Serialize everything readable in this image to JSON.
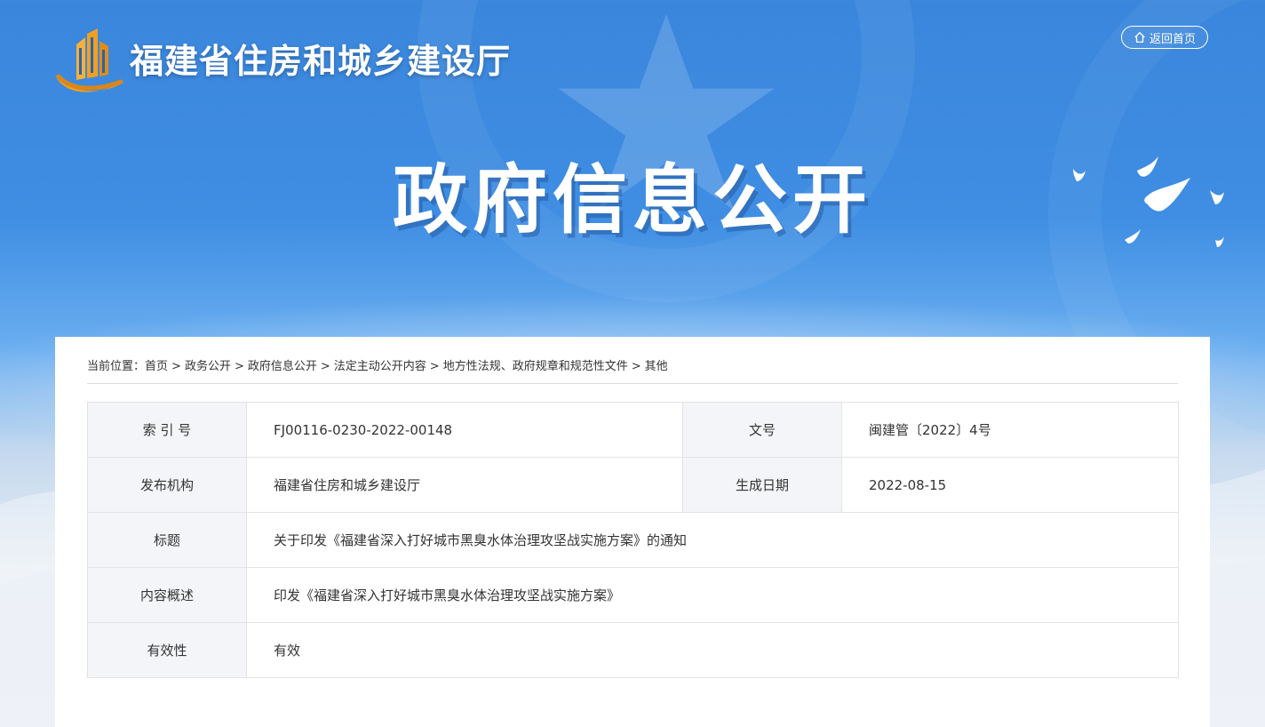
{
  "header": {
    "site_title": "福建省住房和城乡建设厅",
    "home_button_label": "返回首页",
    "banner_title": "政府信息公开"
  },
  "breadcrumb": {
    "prefix": "当前位置：",
    "items": [
      "首页",
      "政务公开",
      "政府信息公开",
      "法定主动公开内容",
      "地方性法规、政府规章和规范性文件",
      "其他"
    ],
    "separator": ">"
  },
  "meta": {
    "index_label": "索 引 号",
    "index_value": "FJ00116-0230-2022-00148",
    "doc_no_label": "文号",
    "doc_no_value": "闽建管〔2022〕4号",
    "publisher_label": "发布机构",
    "publisher_value": "福建省住房和城乡建设厅",
    "date_label": "生成日期",
    "date_value": "2022-08-15",
    "title_label": "标题",
    "title_value": "关于印发《福建省深入打好城市黑臭水体治理攻坚战实施方案》的通知",
    "summary_label": "内容概述",
    "summary_value": "印发《福建省深入打好城市黑臭水体治理攻坚战实施方案》",
    "validity_label": "有效性",
    "validity_value": "有效"
  },
  "colors": {
    "banner_blue": "#3a86dc",
    "label_bg": "#f4f5f8",
    "logo_orange": "#f0a020"
  }
}
